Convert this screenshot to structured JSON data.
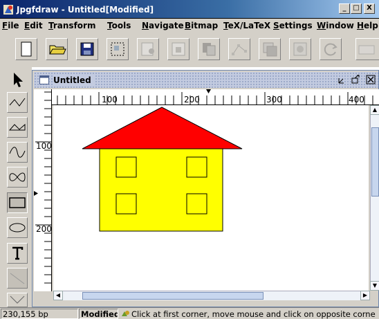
{
  "window": {
    "title": "Jpgfdraw - Untitled[Modified]",
    "minimize": "_",
    "maximize": "□",
    "close": "X"
  },
  "menu": [
    "File",
    "Edit",
    "Transform",
    "Tools",
    "Navigate",
    "Bitmap",
    "TeX/LaTeX",
    "Settings",
    "Window",
    "Help"
  ],
  "toolbar_icons": [
    "new-icon",
    "open-icon",
    "save-icon",
    "select-area-icon",
    "import-icon",
    "export-icon",
    "move-to-front-icon",
    "edit-path-icon",
    "group-icon",
    "ungroup-icon",
    "reverse-path-icon",
    "mirror-icon"
  ],
  "palette_icons": [
    "select-tool-icon",
    "open-line-tool-icon",
    "closed-line-tool-icon",
    "open-curve-tool-icon",
    "closed-curve-tool-icon",
    "rectangle-tool-icon",
    "ellipse-tool-icon",
    "text-tool-icon",
    "math-text-tool-icon",
    "more-tools-icon"
  ],
  "document": {
    "title": "Untitled",
    "unit": "bp"
  },
  "rulers": {
    "horizontal_labels": [
      "100",
      "200",
      "300",
      "400"
    ],
    "vertical_labels": [
      "100",
      "200"
    ]
  },
  "drawing": {
    "roof_color": "#ff0000",
    "wall_color": "#ffff00",
    "outline_color": "#000000",
    "window_count": 4
  },
  "status": {
    "coordinates": "230,155 bp",
    "modified": "Modified",
    "hint": "Click at first corner, move mouse and click on opposite corne"
  }
}
